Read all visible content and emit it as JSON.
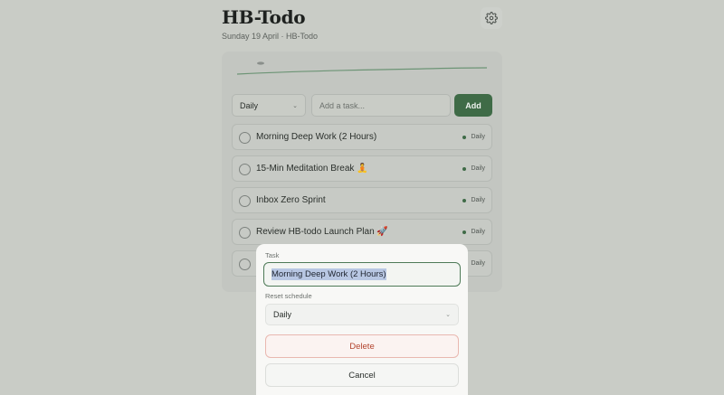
{
  "app": {
    "title": "HB-Todo",
    "subtitle": "Sunday 19 April · HB-Todo"
  },
  "icons": {
    "settings": "gear-icon"
  },
  "form": {
    "schedule_value": "Daily",
    "task_placeholder": "Add a task...",
    "add_label": "Add"
  },
  "tasks": [
    {
      "label": "Morning Deep Work (2 Hours)",
      "schedule": "Daily",
      "done": false
    },
    {
      "label": "15-Min Meditation Break 🧘",
      "schedule": "Daily",
      "done": false
    },
    {
      "label": "Inbox Zero Sprint",
      "schedule": "Daily",
      "done": false
    },
    {
      "label": "Review HB-todo Launch Plan 🚀",
      "schedule": "Daily",
      "done": false
    },
    {
      "label": "",
      "schedule": "Daily",
      "done": false
    }
  ],
  "modal": {
    "task_label": "Task",
    "task_value": "Morning Deep Work (2 Hours)",
    "reset_label": "Reset schedule",
    "reset_value": "Daily",
    "delete_label": "Delete",
    "cancel_label": "Cancel"
  },
  "colors": {
    "accent": "#3f6b47",
    "danger": "#b3452f",
    "overlay": "#c9ccc6"
  }
}
